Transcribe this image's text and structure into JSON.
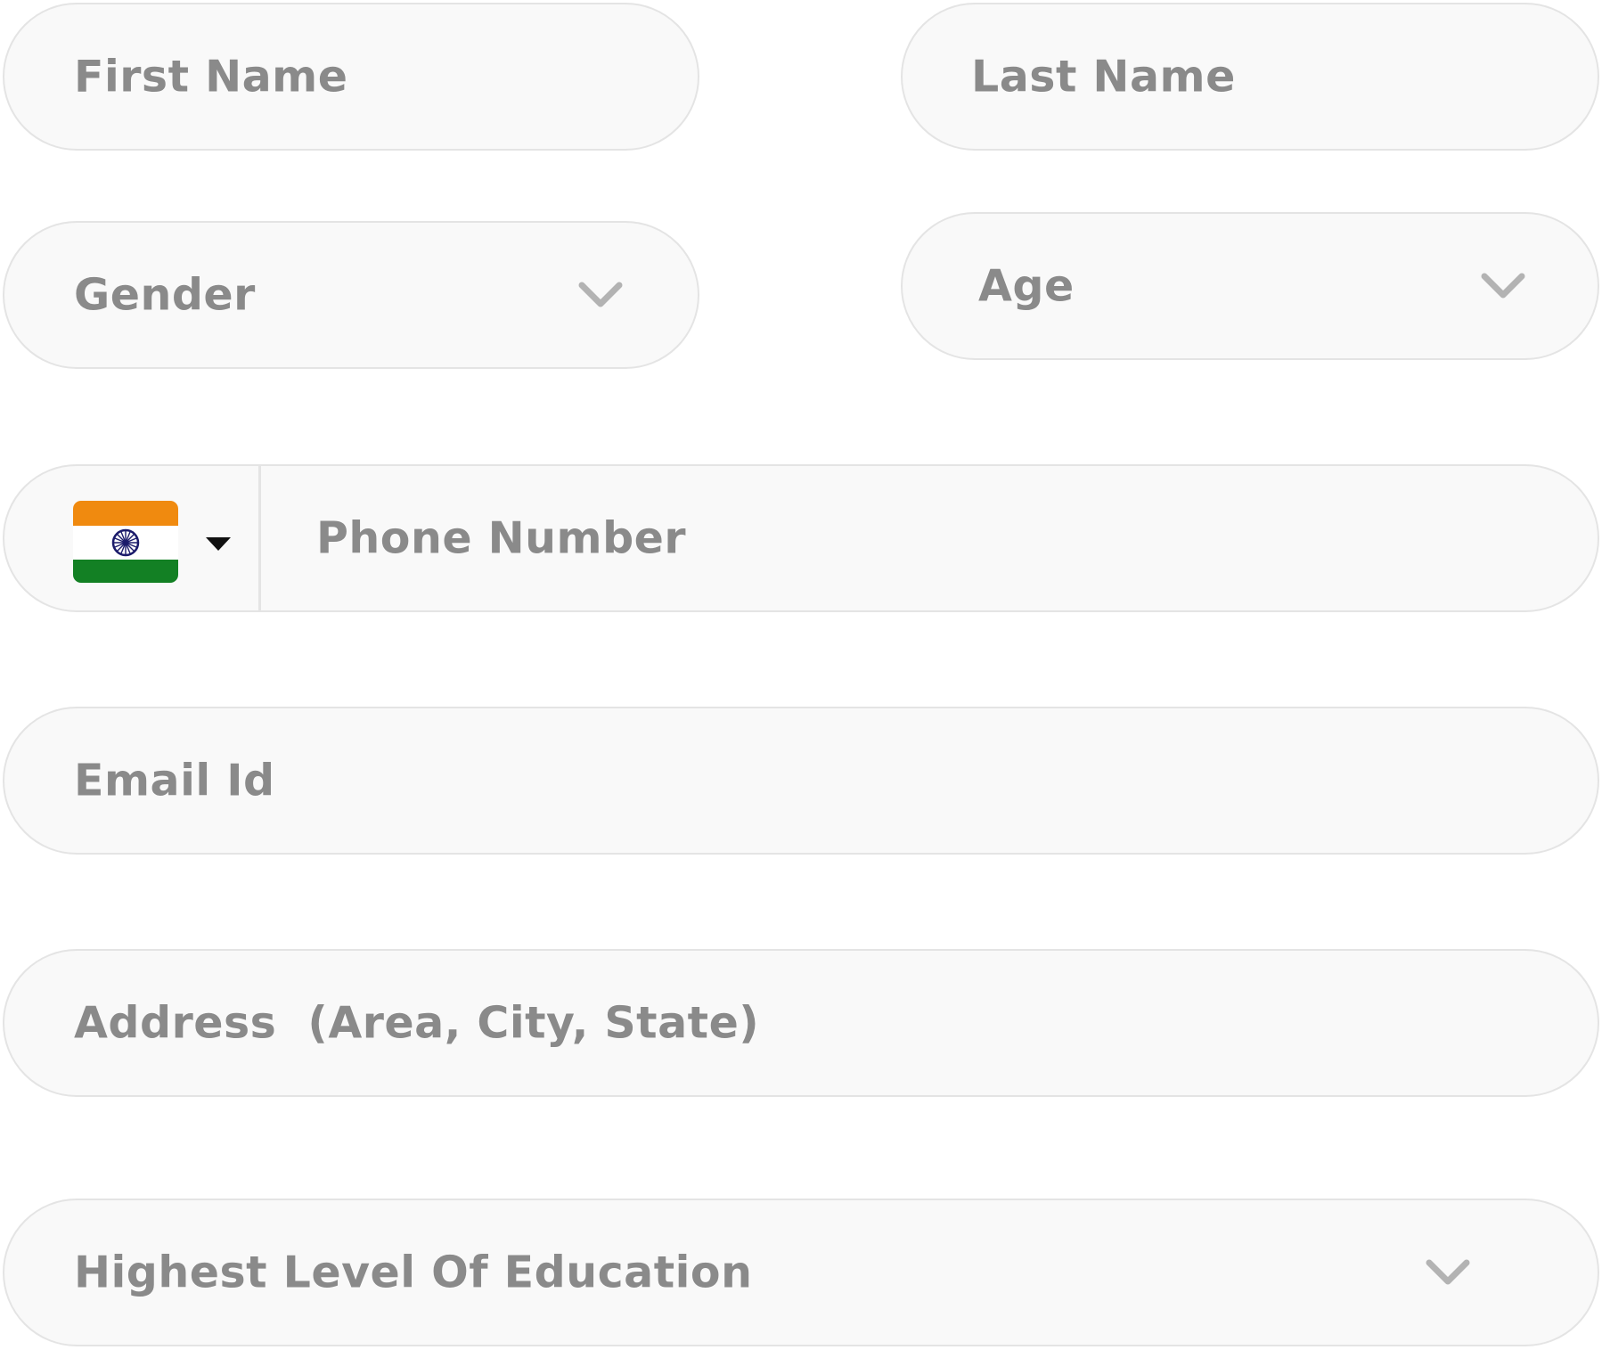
{
  "form": {
    "first_name": {
      "placeholder": "First Name"
    },
    "last_name": {
      "placeholder": "Last Name"
    },
    "gender": {
      "placeholder": "Gender",
      "icon": "chevron-down-icon"
    },
    "age": {
      "placeholder": "Age",
      "icon": "chevron-down-icon"
    },
    "phone": {
      "placeholder": "Phone Number",
      "country_flag_icon": "india-flag-icon",
      "dropdown_icon": "caret-down-icon"
    },
    "email": {
      "placeholder": "Email Id"
    },
    "address": {
      "placeholder": "Address  (Area, City, State)"
    },
    "education": {
      "placeholder": "Highest Level Of Education",
      "icon": "chevron-down-icon"
    }
  },
  "colors": {
    "field_background": "#f9f9f9",
    "field_border": "#e4e4e4",
    "placeholder_text": "#8a8a8a",
    "chevron": "#b3b3b3",
    "flag_saffron": "#f08a0f",
    "flag_white": "#ffffff",
    "flag_green": "#138024",
    "flag_chakra": "#1b1b6b"
  }
}
